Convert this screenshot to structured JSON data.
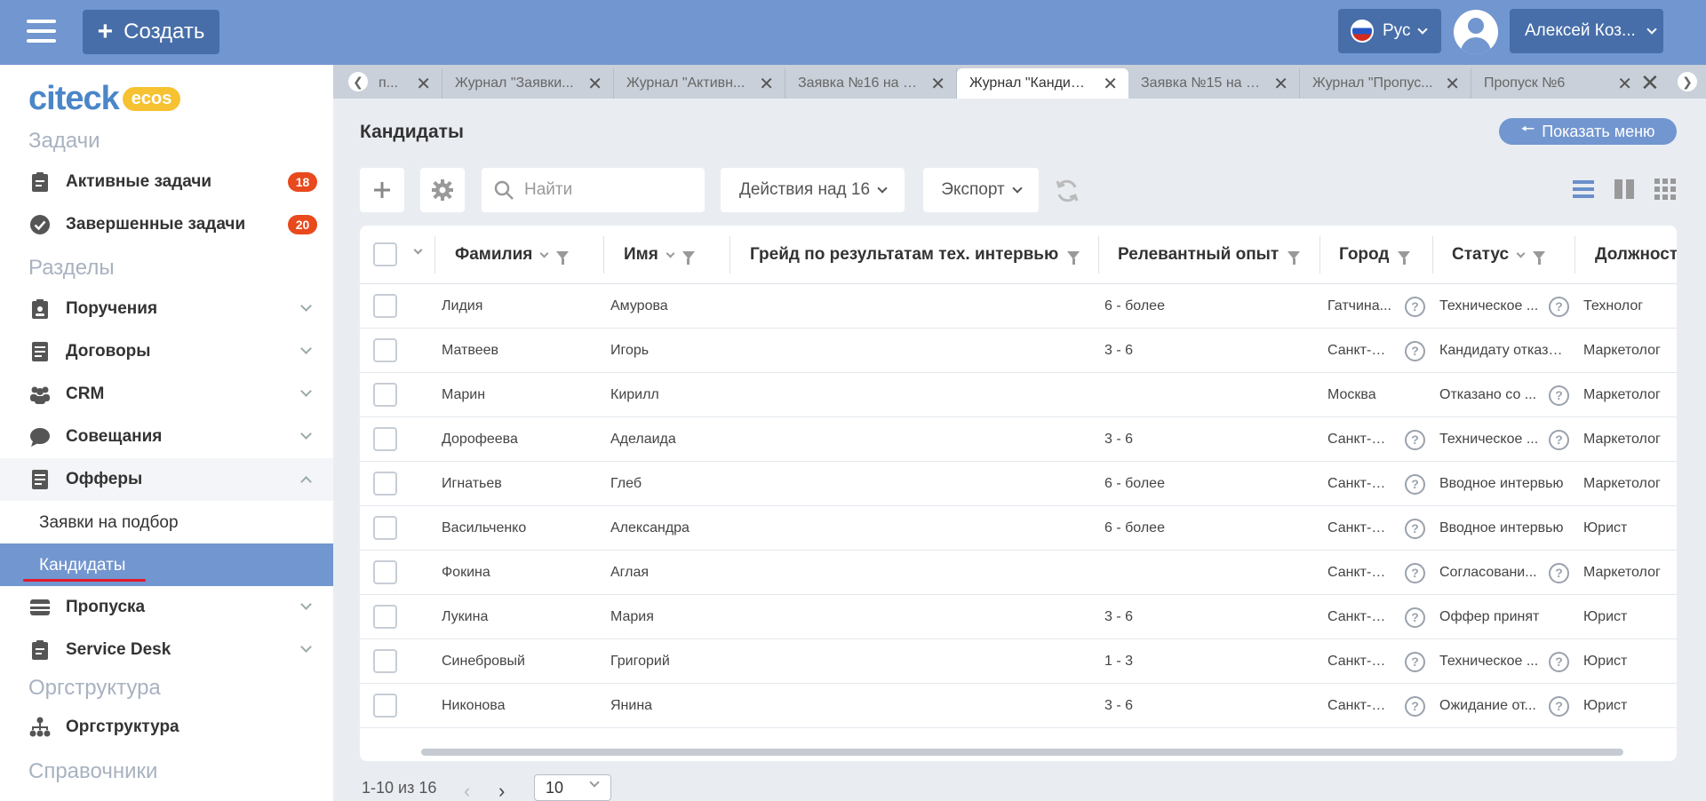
{
  "topbar": {
    "create_label": "Создать",
    "lang_label": "Рус",
    "user_label": "Алексей Коз..."
  },
  "sidebar": {
    "logo_text": "citeck",
    "logo_badge": "ecos",
    "sections": {
      "tasks": "Задачи",
      "sections": "Разделы",
      "orgstructure": "Оргструктура",
      "references": "Справочники"
    },
    "tasks": [
      {
        "label": "Активные задачи",
        "badge": "18",
        "icon": "clipboard-icon"
      },
      {
        "label": "Завершенные задачи",
        "badge": "20",
        "icon": "check-circle-icon"
      }
    ],
    "items": [
      {
        "label": "Поручения",
        "icon": "clipboard-user-icon"
      },
      {
        "label": "Договоры",
        "icon": "document-icon"
      },
      {
        "label": "CRM",
        "icon": "people-icon"
      },
      {
        "label": "Совещания",
        "icon": "chat-icon"
      },
      {
        "label": "Офферы",
        "icon": "document-icon"
      },
      {
        "label": "Пропуска",
        "icon": "card-icon"
      },
      {
        "label": "Service Desk",
        "icon": "clipboard-icon"
      }
    ],
    "offers_sub": [
      {
        "label": "Заявки на подбор"
      },
      {
        "label": "Кандидаты"
      }
    ],
    "org_item": {
      "label": "Оргструктура",
      "icon": "org-tree-icon"
    }
  },
  "tabs": [
    {
      "label": "п..."
    },
    {
      "label": "Журнал \"Заявки..."
    },
    {
      "label": "Журнал \"Активн..."
    },
    {
      "label": "Заявка №16 на п..."
    },
    {
      "label": "Журнал \"Кандид..."
    },
    {
      "label": "Заявка №15 на п..."
    },
    {
      "label": "Журнал \"Пропус..."
    },
    {
      "label": "Пропуск №6"
    }
  ],
  "page": {
    "title": "Кандидаты",
    "show_menu": "Показать меню"
  },
  "toolbar": {
    "search_placeholder": "Найти",
    "actions_label": "Действия над 16",
    "export_label": "Экспорт"
  },
  "table": {
    "columns": [
      "Фамилия",
      "Имя",
      "Грейд по результатам тех. интервью",
      "Релевантный опыт",
      "Город",
      "Статус",
      "Должност"
    ],
    "rows": [
      {
        "last": "Лидия",
        "first": "Амурова",
        "grade": "",
        "exp": "6 - более",
        "city": "Гатчина...",
        "city_q": true,
        "status": "Техническое ...",
        "status_q": true,
        "pos": "Технолог"
      },
      {
        "last": "Матвеев",
        "first": "Игорь",
        "grade": "",
        "exp": "3 - 6",
        "city": "Санкт-П...",
        "city_q": true,
        "status": "Кандидату отказано",
        "status_q": false,
        "pos": "Маркетолог"
      },
      {
        "last": "Марин",
        "first": "Кирилл",
        "grade": "",
        "exp": "",
        "city": "Москва",
        "city_q": false,
        "status": "Отказано со ...",
        "status_q": true,
        "pos": "Маркетолог"
      },
      {
        "last": "Дорофеева",
        "first": "Аделаида",
        "grade": "",
        "exp": "3 - 6",
        "city": "Санкт-П...",
        "city_q": true,
        "status": "Техническое ...",
        "status_q": true,
        "pos": "Маркетолог"
      },
      {
        "last": "Игнатьев",
        "first": "Глеб",
        "grade": "",
        "exp": "6 - более",
        "city": "Санкт-П...",
        "city_q": true,
        "status": "Вводное интервью",
        "status_q": false,
        "pos": "Маркетолог"
      },
      {
        "last": "Васильченко",
        "first": "Александра",
        "grade": "",
        "exp": "6 - более",
        "city": "Санкт-П...",
        "city_q": true,
        "status": "Вводное интервью",
        "status_q": false,
        "pos": "Юрист"
      },
      {
        "last": "Фокина",
        "first": "Аглая",
        "grade": "",
        "exp": "",
        "city": "Санкт-П...",
        "city_q": true,
        "status": "Согласовани...",
        "status_q": true,
        "pos": "Маркетолог"
      },
      {
        "last": "Лукина",
        "first": "Мария",
        "grade": "",
        "exp": "3 - 6",
        "city": "Санкт-П...",
        "city_q": true,
        "status": "Оффер принят",
        "status_q": false,
        "pos": "Юрист"
      },
      {
        "last": "Синебровый",
        "first": "Григорий",
        "grade": "",
        "exp": "1 - 3",
        "city": "Санкт-П...",
        "city_q": true,
        "status": "Техническое ...",
        "status_q": true,
        "pos": "Юрист"
      },
      {
        "last": "Никонова",
        "first": "Янина",
        "grade": "",
        "exp": "3 - 6",
        "city": "Санкт-П...",
        "city_q": true,
        "status": "Ожидание от...",
        "status_q": true,
        "pos": "Юрист"
      }
    ]
  },
  "pager": {
    "range_text": "1-10 из 16",
    "page_size": "10"
  },
  "colors": {
    "header_blue": "#7296cf",
    "button_blue": "#476ea9",
    "badge_red": "#e8491d"
  }
}
